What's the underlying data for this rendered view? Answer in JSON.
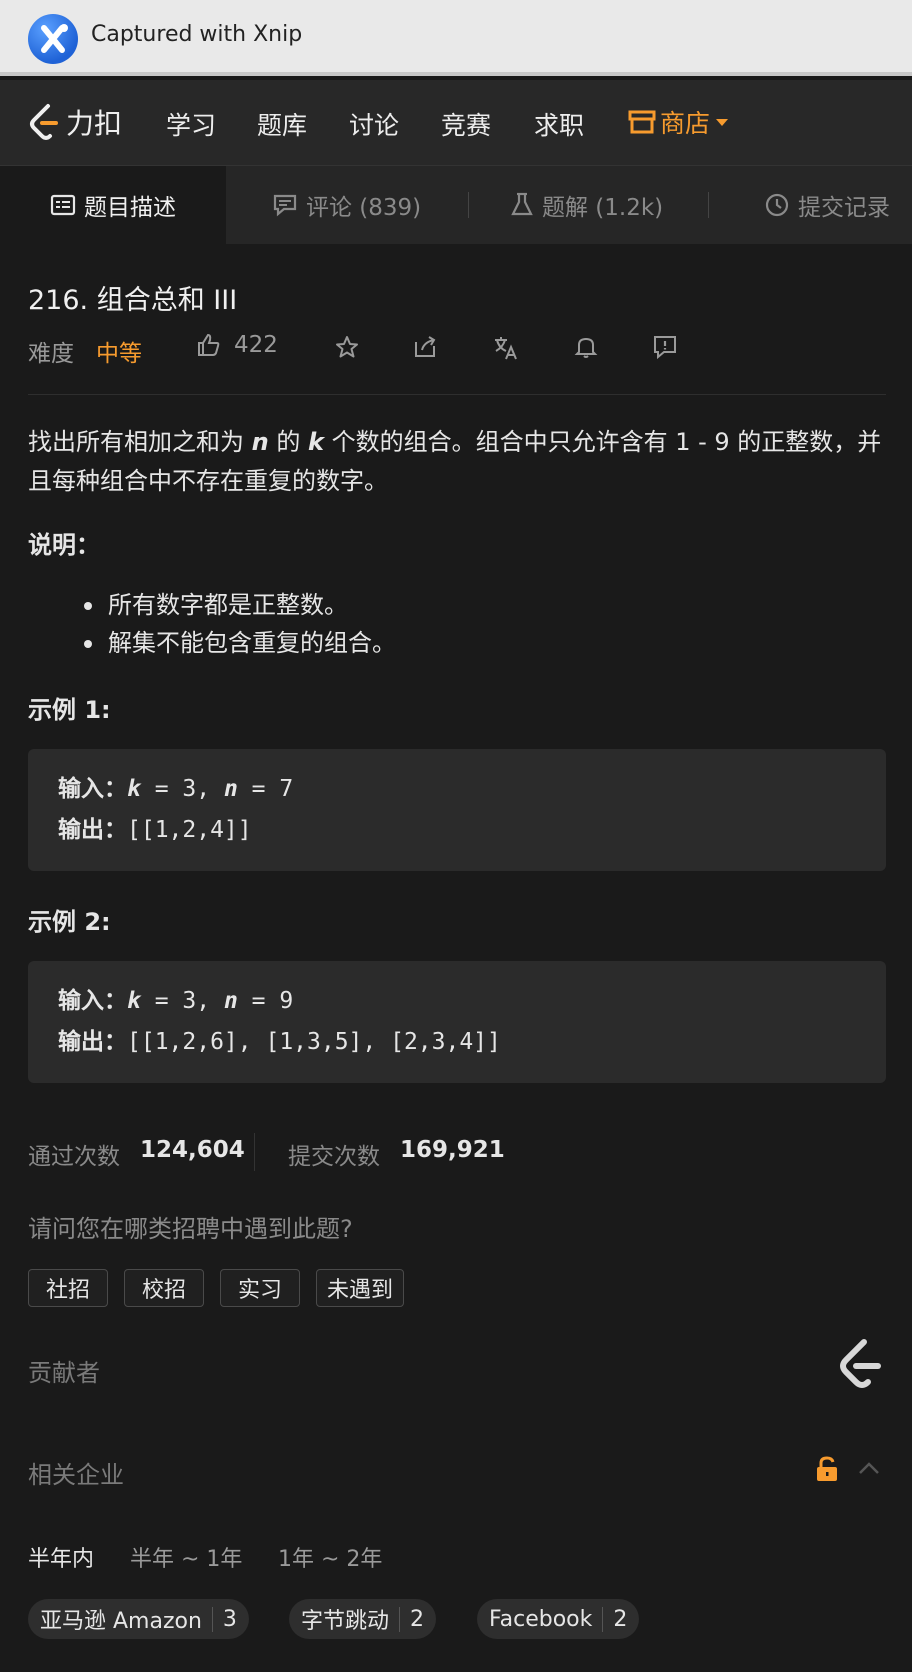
{
  "capture": {
    "text": "Captured with Xnip",
    "icon": "xnip-icon"
  },
  "nav": {
    "brand": "力扣",
    "items": [
      "学习",
      "题库",
      "讨论",
      "竞赛",
      "求职"
    ],
    "store": "商店",
    "accent": "#f79b2e"
  },
  "tabs": [
    {
      "label": "题目描述",
      "icon": "description-icon"
    },
    {
      "label": "评论 (839)",
      "icon": "comment-icon"
    },
    {
      "label": "题解 (1.2k)",
      "icon": "flask-icon"
    },
    {
      "label": "提交记录",
      "icon": "clock-icon"
    }
  ],
  "problem": {
    "title": "216. 组合总和 III",
    "difficulty_label": "难度",
    "difficulty": "中等",
    "likes": "422"
  },
  "description": {
    "p1_a": "找出所有相加之和为 ",
    "var_n": "n",
    "p1_b": " 的 ",
    "var_k": "k",
    "p1_c": " 个数的组合。组合中只允许含有 1 - 9 的正整数，并且每种组合中不存在重复的数字。",
    "note_heading": "说明：",
    "notes": [
      "所有数字都是正整数。",
      "解集不能包含重复的组合。"
    ]
  },
  "examples": [
    {
      "heading": "示例 1:",
      "input_label": "输入：",
      "input_k": "k",
      "input_mid": " = 3, ",
      "input_n": "n",
      "input_end": " = 7",
      "output_label": "输出：",
      "output": "[[1,2,4]]"
    },
    {
      "heading": "示例 2:",
      "input_label": "输入：",
      "input_k": "k",
      "input_mid": " = 3, ",
      "input_n": "n",
      "input_end": " = 9",
      "output_label": "输出：",
      "output": "[[1,2,6], [1,3,5], [2,3,4]]"
    }
  ],
  "stats": {
    "accepted_label": "通过次数",
    "accepted": "124,604",
    "submitted_label": "提交次数",
    "submitted": "169,921"
  },
  "survey": {
    "question": "请问您在哪类招聘中遇到此题?",
    "options": [
      "社招",
      "校招",
      "实习",
      "未遇到"
    ]
  },
  "contributors": {
    "label": "贡献者"
  },
  "companies": {
    "label": "相关企业",
    "periods": [
      "半年内",
      "半年 ~ 1年",
      "1年 ~ 2年"
    ],
    "tags": [
      {
        "name": "亚马逊 Amazon",
        "count": "3"
      },
      {
        "name": "字节跳动",
        "count": "2"
      },
      {
        "name": "Facebook",
        "count": "2"
      }
    ]
  }
}
